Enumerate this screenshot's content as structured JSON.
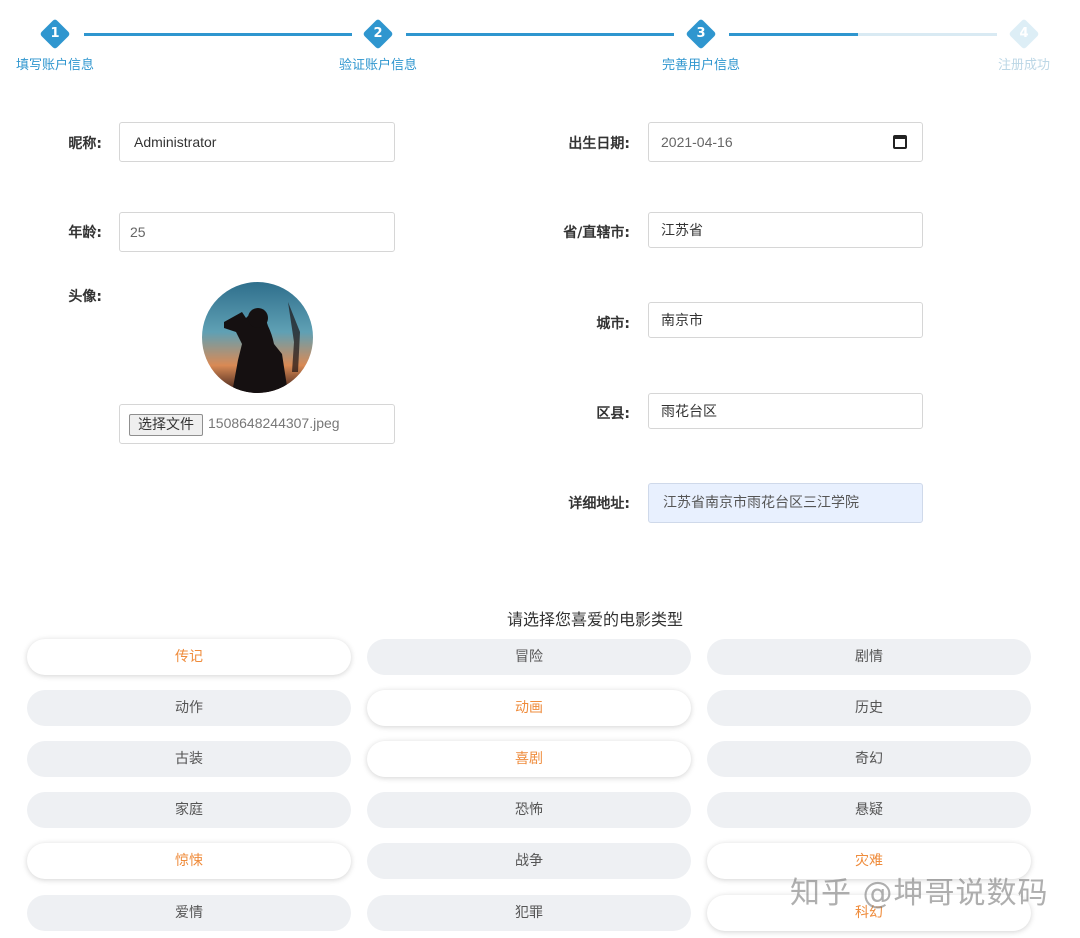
{
  "steps": [
    {
      "number": "1",
      "label": "填写账户信息"
    },
    {
      "number": "2",
      "label": "验证账户信息"
    },
    {
      "number": "3",
      "label": "完善用户信息"
    },
    {
      "number": "4",
      "label": "注册成功"
    }
  ],
  "progress": {
    "current_step": 3,
    "total_steps": 4
  },
  "form": {
    "nickname": {
      "label": "昵称:",
      "value": "Administrator"
    },
    "age": {
      "label": "年龄:",
      "value": "25"
    },
    "avatar": {
      "label": "头像:",
      "choose_button": "选择文件",
      "file_name": "1508648244307.jpeg"
    },
    "birth_date": {
      "label": "出生日期:",
      "value": "2021-04-16"
    },
    "province": {
      "label": "省/直辖市:",
      "value": "江苏省"
    },
    "city": {
      "label": "城市:",
      "value": "南京市"
    },
    "district": {
      "label": "区县:",
      "value": "雨花台区"
    },
    "address": {
      "label": "详细地址:",
      "value": "江苏省南京市雨花台区三江学院"
    }
  },
  "genres": {
    "title": "请选择您喜爱的电影类型",
    "items": [
      {
        "label": "传记",
        "selected": true
      },
      {
        "label": "冒险",
        "selected": false
      },
      {
        "label": "剧情",
        "selected": false
      },
      {
        "label": "动作",
        "selected": false
      },
      {
        "label": "动画",
        "selected": true
      },
      {
        "label": "历史",
        "selected": false
      },
      {
        "label": "古装",
        "selected": false
      },
      {
        "label": "喜剧",
        "selected": true
      },
      {
        "label": "奇幻",
        "selected": false
      },
      {
        "label": "家庭",
        "selected": false
      },
      {
        "label": "恐怖",
        "selected": false
      },
      {
        "label": "悬疑",
        "selected": false
      },
      {
        "label": "惊悚",
        "selected": true
      },
      {
        "label": "战争",
        "selected": false
      },
      {
        "label": "灾难",
        "selected": true
      },
      {
        "label": "爱情",
        "selected": false
      },
      {
        "label": "犯罪",
        "selected": false
      },
      {
        "label": "科幻",
        "selected": true
      }
    ]
  },
  "colors": {
    "accent": "#2f96cf",
    "selected_text": "#ef8c3c",
    "pill_bg": "#eef0f3"
  },
  "watermark": "知乎 @坤哥说数码"
}
